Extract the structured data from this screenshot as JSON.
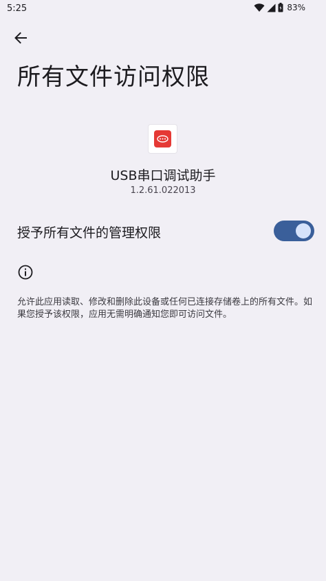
{
  "status_bar": {
    "time": "5:25",
    "battery": "83%",
    "icons": [
      "wifi-icon",
      "signal-icon",
      "battery-icon"
    ]
  },
  "header": {
    "back_icon": "arrow-left-icon",
    "title": "所有文件访问权限"
  },
  "app": {
    "name": "USB串口调试助手",
    "version": "1.2.61.022013",
    "icon_color": "#e53935"
  },
  "permission": {
    "label": "授予所有文件的管理权限",
    "enabled": true,
    "toggle_color": "#3a5f9a"
  },
  "info": {
    "icon": "info-icon",
    "description": "允许此应用读取、修改和删除此设备或任何已连接存储卷上的所有文件。如果您授予该权限，应用无需明确通知您即可访问文件。"
  }
}
